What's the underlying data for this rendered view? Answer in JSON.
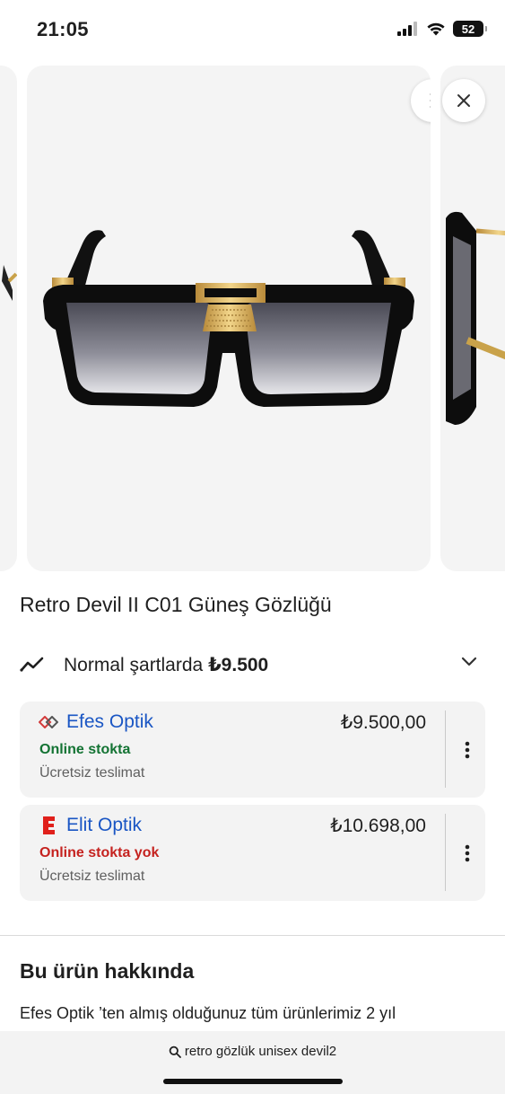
{
  "status_bar": {
    "time": "21:05",
    "battery": "52",
    "icons": [
      "cellular-signal-icon",
      "wifi-icon",
      "battery-icon"
    ]
  },
  "gallery": {
    "images": [
      "sunglasses-partial-left",
      "sunglasses-front",
      "sunglasses-side"
    ],
    "buttons": [
      "more-vert-icon",
      "close-icon"
    ]
  },
  "product": {
    "title": "Retro Devil II C01 Güneş Gözlüğü"
  },
  "price_summary": {
    "label": "Normal şartlarda ",
    "price": "₺9.500"
  },
  "sellers": [
    {
      "name": "Efes Optik",
      "price": "₺9.500,00",
      "stock": "Online stokta",
      "delivery": "Ücretsiz teslimat",
      "stock_color": "#137333"
    },
    {
      "name": "Elit Optik",
      "price": "₺10.698,00",
      "stock": "Online stokta yok",
      "delivery": "Ücretsiz teslimat",
      "stock_color": "#c5221f"
    }
  ],
  "about": {
    "heading": "Bu ürün hakkında",
    "text": "Efes Optik ’ten almış olduğunuz tüm ürünlerimiz 2 yıl"
  },
  "bottom_search": {
    "query": "retro gözlük unisex devil2"
  },
  "colors": {
    "link_blue": "#1a56c4",
    "in_stock_green": "#137333",
    "out_of_stock_red": "#c5221f",
    "card_bg": "#f3f3f3"
  }
}
